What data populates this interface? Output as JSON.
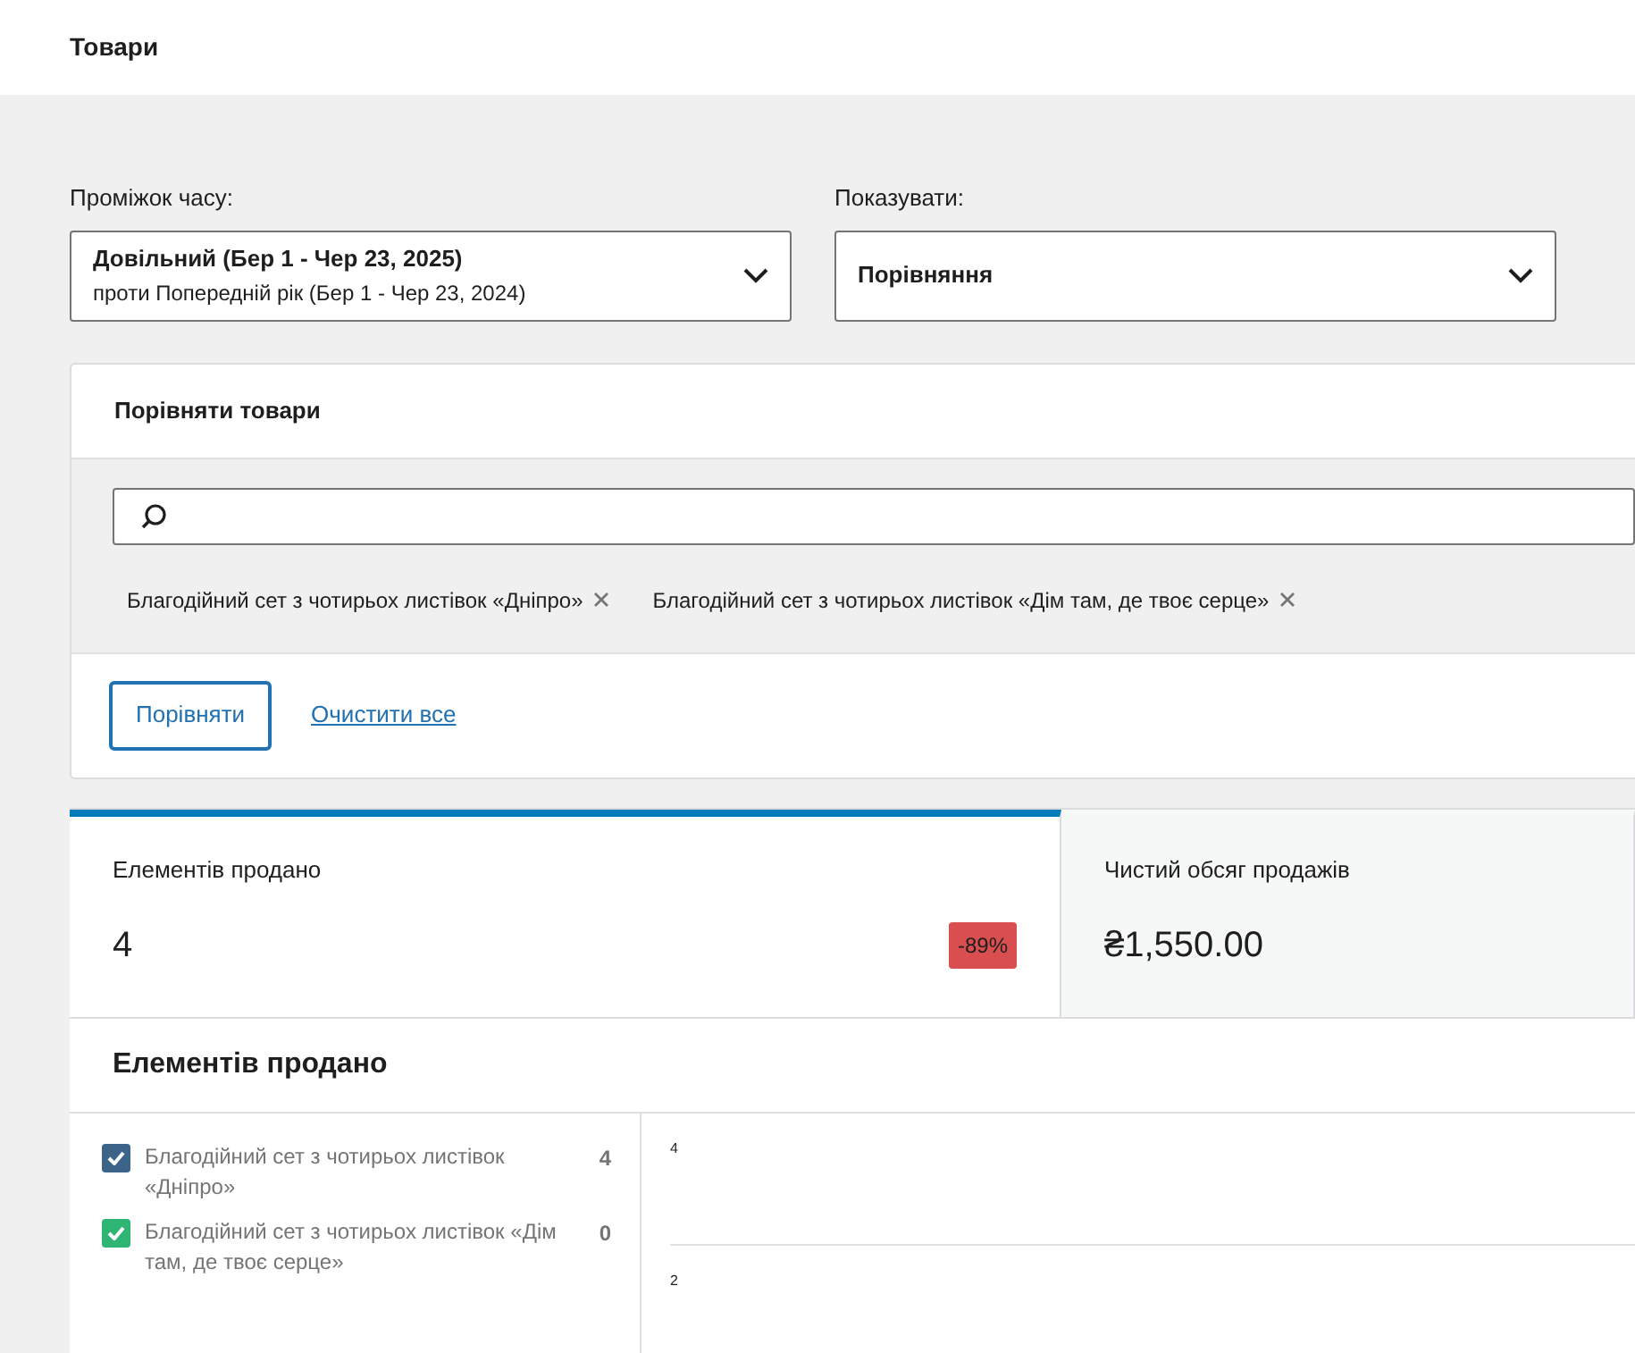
{
  "header": {
    "title": "Товари"
  },
  "filters": [
    {
      "label": "Проміжок часу:",
      "value": "Довільний (Бер 1 - Чер 23, 2025)",
      "secondary": "проти Попередній рік (Бер 1 - Чер 23, 2024)"
    },
    {
      "label": "Показувати:",
      "value": "Порівняння"
    }
  ],
  "compare": {
    "title": "Порівняти товари",
    "chips": [
      "Благодійний сет з чотирьох листівок «Дніпро»",
      "Благодійний сет з чотирьох листівок «Дім там, де твоє серце»"
    ],
    "compare_button": "Порівняти",
    "clear_link": "Очистити все"
  },
  "stats": [
    {
      "label": "Елементів продано",
      "value": "4",
      "delta": "-89%",
      "selected": true
    },
    {
      "label": "Чистий обсяг продажів",
      "value": "₴1,550.00",
      "selected": false
    }
  ],
  "chart_panel": {
    "title": "Елементів продано",
    "legend": [
      {
        "label": "Благодійний сет з чотирьох листівок «Дніпро»",
        "total": "4",
        "checked": true,
        "color": "#3c6488"
      },
      {
        "label": "Благодійний сет з чотирьох листівок «Дім там, де твоє серце»",
        "total": "0",
        "checked": true,
        "color": "#2fb573"
      }
    ],
    "y_tick_labels": [
      "4",
      "2"
    ]
  }
}
